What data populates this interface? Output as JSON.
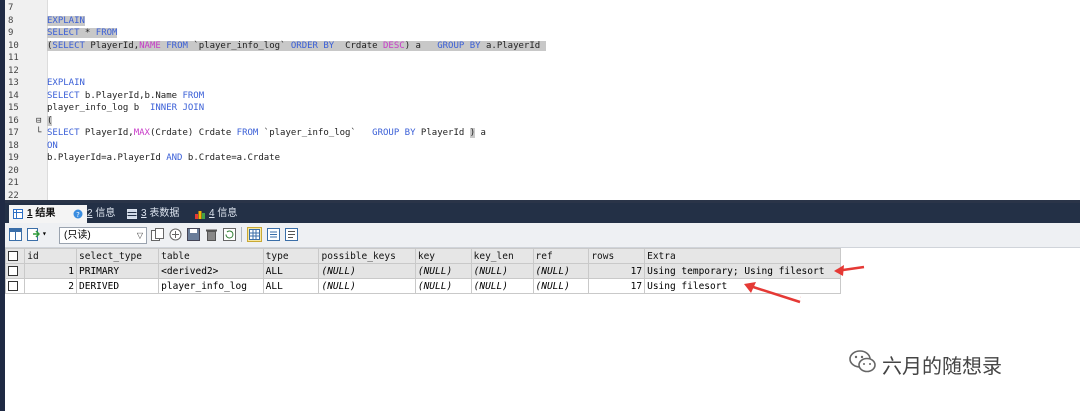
{
  "editor": {
    "lines": [
      {
        "n": "7",
        "html": ""
      },
      {
        "n": "8",
        "html": "<span class='sel kw'>EXPLAIN</span>"
      },
      {
        "n": "9",
        "html": "<span class='sel'><span class='kw'>SELECT</span> * <span class='kw'>FROM</span></span>"
      },
      {
        "n": "10",
        "html": "<span class='sel'>(<span class='kw'>SELECT</span> PlayerId,<span class='fn'>NAME</span> <span class='kw'>FROM</span> `player_info_log` <span class='kw'>ORDER BY</span>  Crdate <span class='fn'>DESC</span>) a   <span class='kw'>GROUP BY</span> a.PlayerId </span>"
      },
      {
        "n": "11",
        "html": ""
      },
      {
        "n": "12",
        "html": ""
      },
      {
        "n": "13",
        "html": "<span class='kw'>EXPLAIN</span>"
      },
      {
        "n": "14",
        "html": "<span class='kw'>SELECT</span> b.PlayerId,b.Name <span class='kw'>FROM</span>"
      },
      {
        "n": "15",
        "html": "player_info_log b  <span class='kw'>INNER JOIN</span>"
      },
      {
        "n": "16",
        "fold": "⊟",
        "html": "<span class='hs'>(</span>"
      },
      {
        "n": "17",
        "fold": "└",
        "html": "<span class='kw'>SELECT</span> PlayerId,<span class='fn'>MAX</span>(Crdate) Crdate <span class='kw'>FROM</span> `player_info_log`   <span class='kw'>GROUP BY</span> PlayerId <span class='hs'>)</span> a"
      },
      {
        "n": "18",
        "html": "<span class='kw'>ON</span>"
      },
      {
        "n": "19",
        "html": "b.PlayerId=a.PlayerId <span class='kw'>AND</span> b.Crdate=a.Crdate"
      },
      {
        "n": "20",
        "html": ""
      },
      {
        "n": "21",
        "html": ""
      },
      {
        "n": "22",
        "html": ""
      }
    ]
  },
  "tabs": [
    {
      "num": "1",
      "label": "结果",
      "active": true,
      "icon": "table-result-icon"
    },
    {
      "num": "2",
      "label": "信息",
      "active": false,
      "icon": "info-icon"
    },
    {
      "num": "3",
      "label": "表数据",
      "active": false,
      "icon": "table-data-icon"
    },
    {
      "num": "4",
      "label": "信息",
      "active": false,
      "icon": "chart-info-icon"
    }
  ],
  "toolbar": {
    "mode_label": "(只读)"
  },
  "grid": {
    "columns": [
      "id",
      "select_type",
      "table",
      "type",
      "possible_keys",
      "key",
      "key_len",
      "ref",
      "rows",
      "Extra"
    ],
    "rows": [
      [
        "1",
        "PRIMARY",
        "<derived2>",
        "ALL",
        "(NULL)",
        "(NULL)",
        "(NULL)",
        "(NULL)",
        "17",
        "Using temporary; Using filesort"
      ],
      [
        "2",
        "DERIVED",
        "player_info_log",
        "ALL",
        "(NULL)",
        "(NULL)",
        "(NULL)",
        "(NULL)",
        "17",
        "Using filesort"
      ]
    ]
  },
  "watermark": {
    "text": "六月的随想录"
  },
  "colors": {
    "keyword": "#3a5fd7",
    "function": "#c83cc8",
    "arrow": "#e53935",
    "selection": "#c8c8c8"
  }
}
